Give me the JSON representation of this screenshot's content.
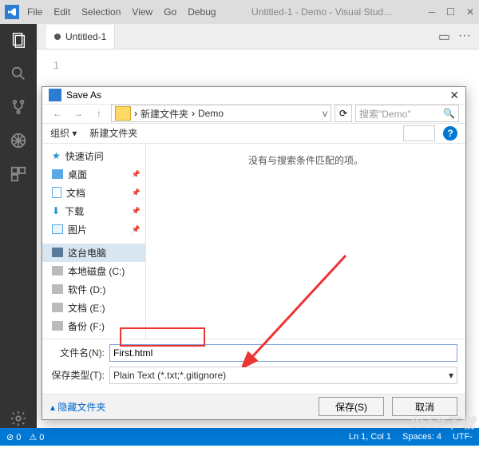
{
  "titlebar": {
    "menus": [
      "File",
      "Edit",
      "Selection",
      "View",
      "Go",
      "Debug"
    ],
    "title": "Untitled-1 - Demo - Visual Stud…"
  },
  "tab": {
    "name": "Untitled-1",
    "dirty": true
  },
  "editor": {
    "line_number": "1"
  },
  "tabbar_icons": {
    "layout": "▭",
    "more": "···"
  },
  "activity": [
    "files",
    "search",
    "git",
    "debug",
    "extensions"
  ],
  "dialog": {
    "title": "Save As",
    "nav": {
      "back": "←",
      "fwd": "→",
      "up": "↑",
      "segments": [
        "新建文件夹",
        "Demo"
      ],
      "search_placeholder": "搜索\"Demo\"",
      "refresh": "⟳"
    },
    "toolbar": {
      "organize": "组织 ▾",
      "newfolder": "新建文件夹",
      "help": "?"
    },
    "tree": {
      "quick": "快速访问",
      "items": [
        {
          "icon": "desktop",
          "label": "桌面",
          "pin": true
        },
        {
          "icon": "doc",
          "label": "文档",
          "pin": true
        },
        {
          "icon": "download",
          "label": "下载",
          "pin": true
        },
        {
          "icon": "pic",
          "label": "图片",
          "pin": true
        }
      ],
      "pc": "这台电脑",
      "disks": [
        "本地磁盘 (C:)",
        "软件 (D:)",
        "文档 (E:)",
        "备份 (F:)"
      ]
    },
    "content_empty": "没有与搜索条件匹配的项。",
    "filename_label": "文件名(N):",
    "filename_value": "First.html",
    "filetype_label": "保存类型(T):",
    "filetype_value": "Plain Text (*.txt;*.gitignore)",
    "hide_folders": "▴ 隐藏文件夹",
    "save": "保存(S)",
    "cancel": "取消"
  },
  "status": {
    "errors": "⊘ 0",
    "warnings": "⚠ 0",
    "ln": "Ln 1, Col 1",
    "spaces": "Spaces: 4",
    "encoding": "UTF-"
  },
  "watermark": "9553下载"
}
